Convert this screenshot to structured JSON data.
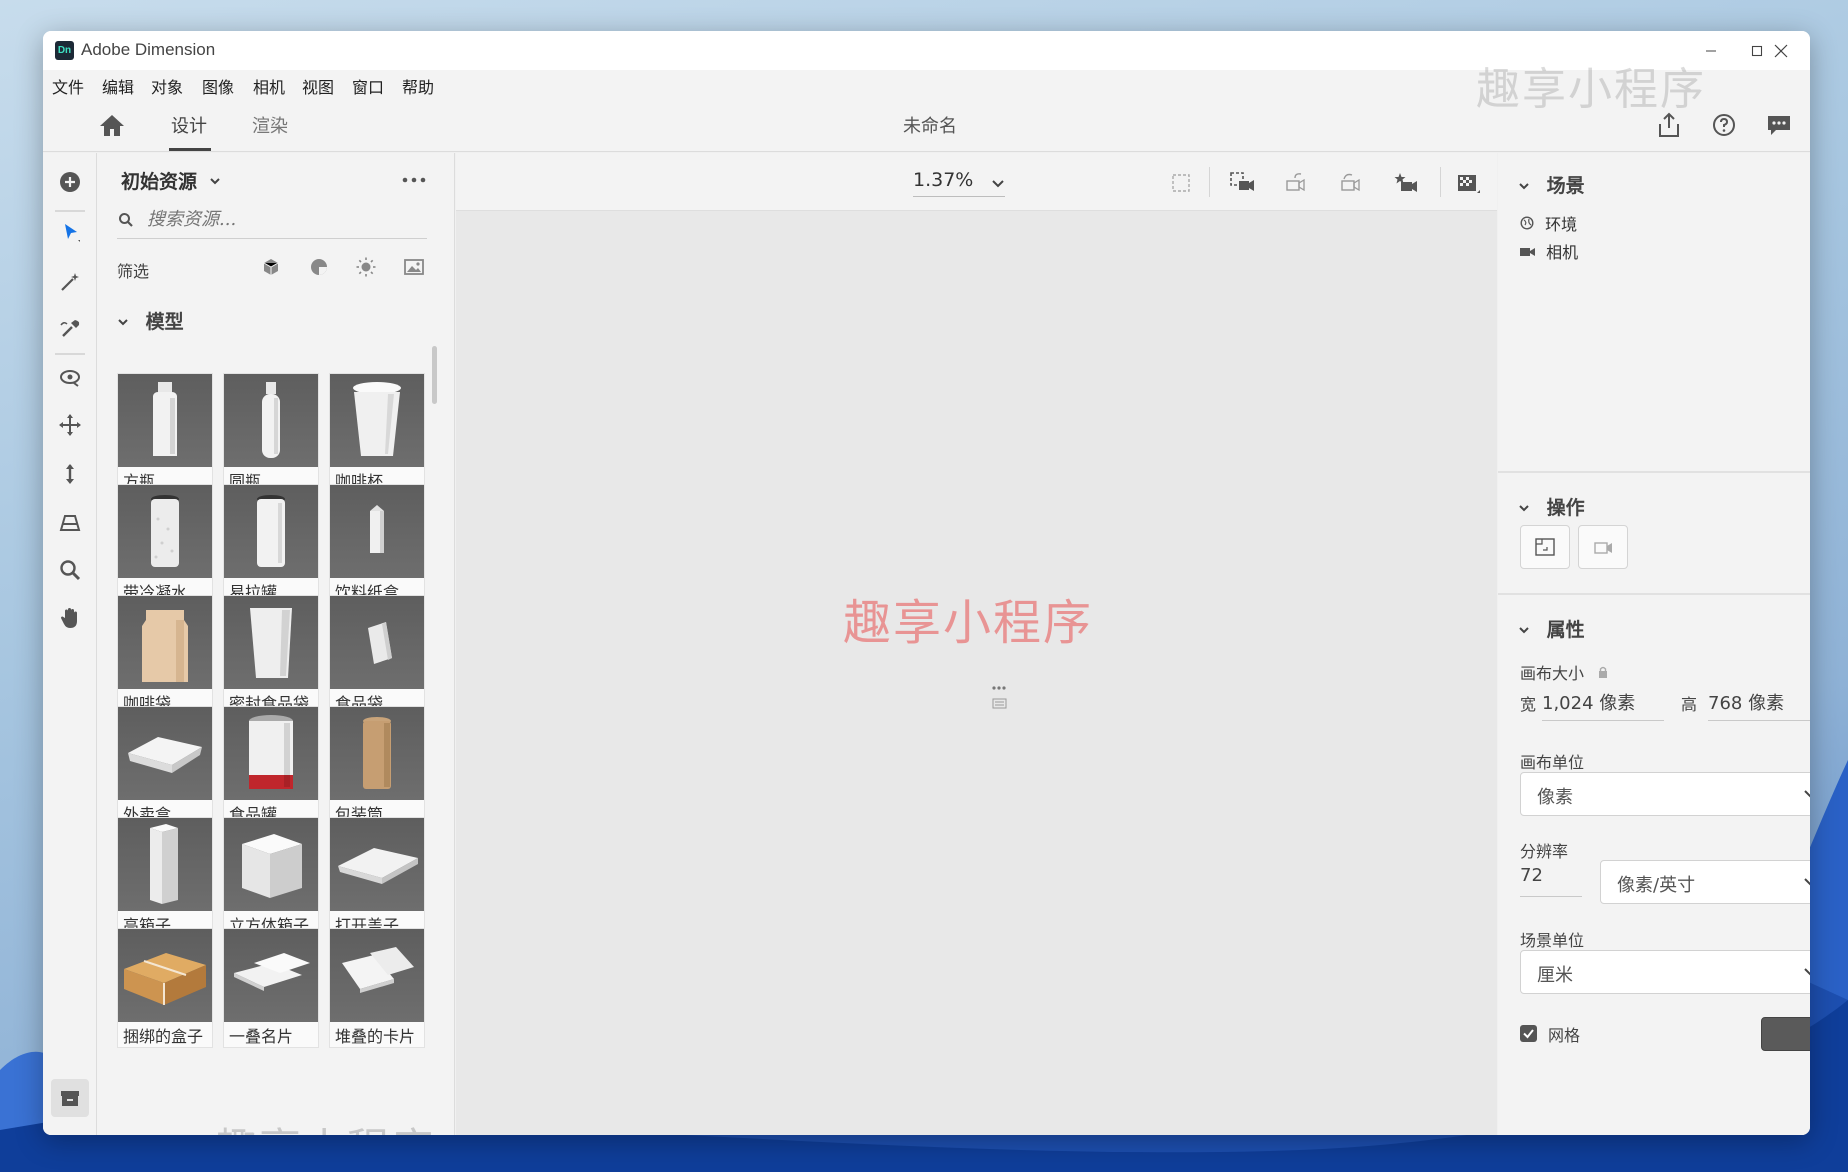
{
  "window": {
    "title": "Adobe Dimension",
    "app_icon_text": "Dn"
  },
  "menu": [
    "文件",
    "编辑",
    "对象",
    "图像",
    "相机",
    "视图",
    "窗口",
    "帮助"
  ],
  "nav": {
    "tabs": [
      "设计",
      "渲染"
    ],
    "active_tab": "设计",
    "doc_title": "未命名"
  },
  "assets": {
    "header": "初始资源",
    "search_placeholder": "搜索资源...",
    "filter_label": "筛选",
    "section": "模型",
    "items": [
      "方瓶",
      "圆瓶",
      "咖啡杯",
      "带冷凝水...",
      "易拉罐",
      "饮料纸盒",
      "咖啡袋",
      "密封食品袋",
      "食品袋",
      "外卖盒",
      "食品罐",
      "包装筒",
      "高箱子",
      "立方体箱子",
      "打开盖子...",
      "捆绑的盒子",
      "一叠名片",
      "堆叠的卡片"
    ]
  },
  "canvas": {
    "zoom": "1.37%",
    "watermark": "趣享小程序"
  },
  "right_panel": {
    "scene_title": "场景",
    "scene_items": [
      "环境",
      "相机"
    ],
    "actions_title": "操作",
    "props_title": "属性",
    "canvas_size_label": "画布大小",
    "width_label": "宽",
    "width_value": "1,024 像素",
    "height_label": "高",
    "height_value": "768 像素",
    "canvas_unit_label": "画布单位",
    "canvas_unit_value": "像素",
    "resolution_label": "分辨率",
    "resolution_value": "72",
    "resolution_unit": "像素/英寸",
    "scene_unit_label": "场景单位",
    "scene_unit_value": "厘米",
    "grid_label": "网格",
    "grid_checked": true,
    "grid_color": "#5a5a5a"
  },
  "watermarks": {
    "top": "趣享小程序",
    "bottom": "趣享小程序"
  },
  "colors": {
    "accent": "#1473e6",
    "window_bg": "#f3f3f3"
  }
}
